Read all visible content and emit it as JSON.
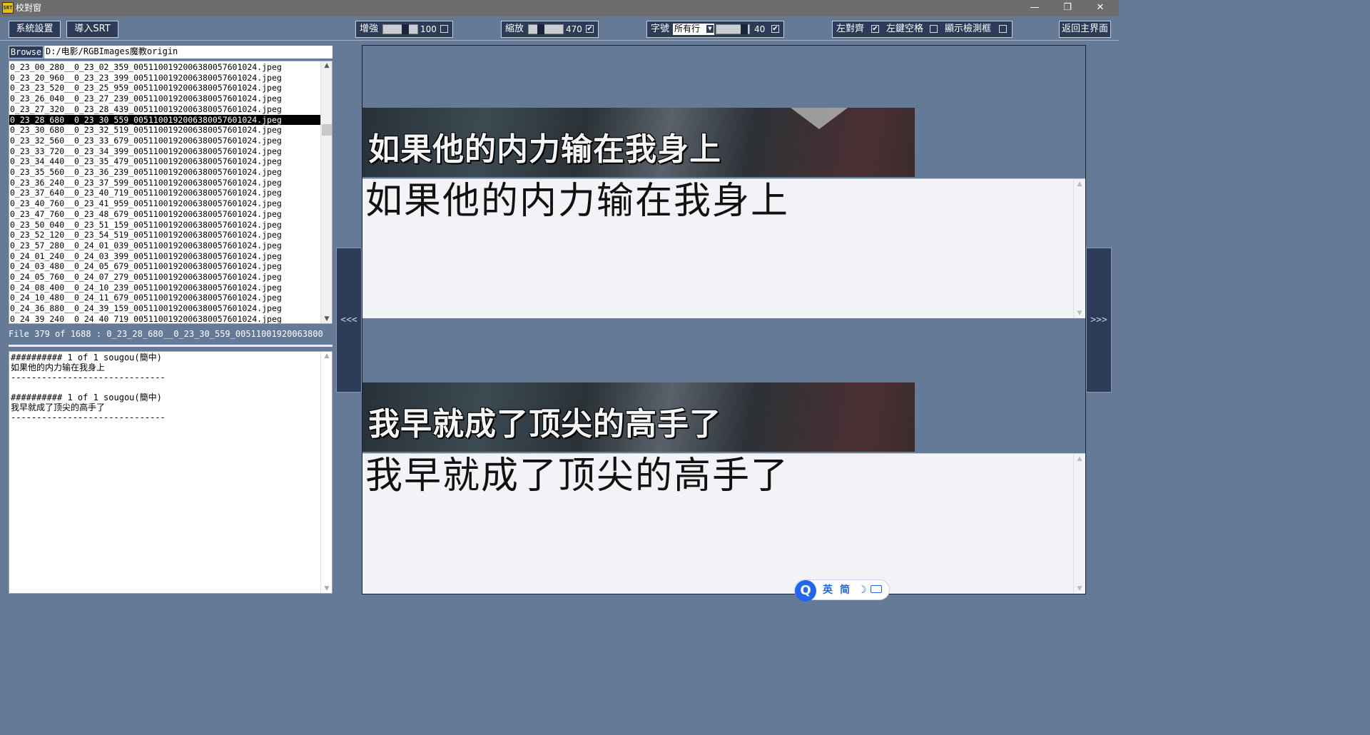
{
  "window": {
    "title": "校對窗",
    "app_icon": "SRT",
    "controls": [
      "—",
      "❐",
      "✕"
    ]
  },
  "toolbar": {
    "system_settings": "系統設置",
    "import_srt": "導入SRT",
    "enhance": {
      "label": "增強",
      "value": "100",
      "checked": false
    },
    "zoom": {
      "label": "縮放",
      "value": "470",
      "checked": true
    },
    "font": {
      "label": "字號",
      "select_value": "所有行",
      "value": "40",
      "checked": true
    },
    "left_align": {
      "label": "左對齊",
      "checked": true
    },
    "left_space": {
      "label": "左鍵空格",
      "checked": false
    },
    "show_detect_box": {
      "label": "顯示檢測框",
      "checked": false
    },
    "back_main": "返回主界面"
  },
  "browse": {
    "button": "Browse",
    "path": "D:/电影/RGBImages魔教origin"
  },
  "file_list": {
    "selected_index": 5,
    "items": [
      "0_23_00_280__0_23_02_359_00511001920063800576010​24.jpeg",
      "0_23_20_960__0_23_23_399_0051100192006380057601024.jpeg",
      "0_23_23_520__0_23_25_959_0051100192006380057601024.jpeg",
      "0_23_26_040__0_23_27_239_0051100192006380057601024.jpeg",
      "0_23_27_320__0_23_28_439_0051100192006380057601024.jpeg",
      "0_23_28_680__0_23_30_559_0051100192006380057601024.jpeg",
      "0_23_30_680__0_23_32_519_0051100192006380057601024.jpeg",
      "0_23_32_560__0_23_33_679_0051100192006380057601024.jpeg",
      "0_23_33_720__0_23_34_399_0051100192006380057601024.jpeg",
      "0_23_34_440__0_23_35_479_0051100192006380057601024.jpeg",
      "0_23_35_560__0_23_36_239_0051100192006380057601024.jpeg",
      "0_23_36_240__0_23_37_599_0051100192006380057601024.jpeg",
      "0_23_37_640__0_23_40_719_0051100192006380057601024.jpeg",
      "0_23_40_760__0_23_41_959_0051100192006380057601024.jpeg",
      "0_23_47_760__0_23_48_679_0051100192006380057601024.jpeg",
      "0_23_50_040__0_23_51_159_0051100192006380057601024.jpeg",
      "0_23_52_120__0_23_54_519_0051100192006380057601024.jpeg",
      "0_23_57_280__0_24_01_039_0051100192006380057601024.jpeg",
      "0_24_01_240__0_24_03_399_0051100192006380057601024.jpeg",
      "0_24_03_480__0_24_05_679_0051100192006380057601024.jpeg",
      "0_24_05_760__0_24_07_279_0051100192006380057601024.jpeg",
      "0_24_08_400__0_24_10_239_0051100192006380057601024.jpeg",
      "0_24_10_480__0_24_11_679_0051100192006380057601024.jpeg",
      "0_24_36_880__0_24_39_159_0051100192006380057601024.jpeg",
      "0_24_39_240__0_24_40_719_0051100192006380057601024.jpeg"
    ]
  },
  "status": {
    "text": "File 379 of 1688 :  0_23_28_680__0_23_30_559_00511001920063800"
  },
  "ocr_log": {
    "lines": [
      "########## 1 of 1 sougou(簡中)",
      "如果他的内力输在我身上",
      "------------------------------",
      "",
      "########## 1 of 1 sougou(簡中)",
      "我早就成了顶尖的高手了",
      "------------------------------"
    ]
  },
  "nav": {
    "prev": "<<<",
    "next": ">>>"
  },
  "subtitles": [
    {
      "image_text": "如果他的内力输在我身上",
      "edit_text": "如果他的内力输在我身上"
    },
    {
      "image_text": "我早就成了顶尖的高手了",
      "edit_text": "我早就成了顶尖的高手了"
    }
  ],
  "ime": {
    "logo": "Q",
    "lang": "英",
    "mode": "简",
    "moon_icon": "moon-icon",
    "keyboard_icon": "keyboard-icon"
  },
  "colors": {
    "background": "#647a96",
    "button_dark": "#2b3b58",
    "selection": "#000000"
  }
}
